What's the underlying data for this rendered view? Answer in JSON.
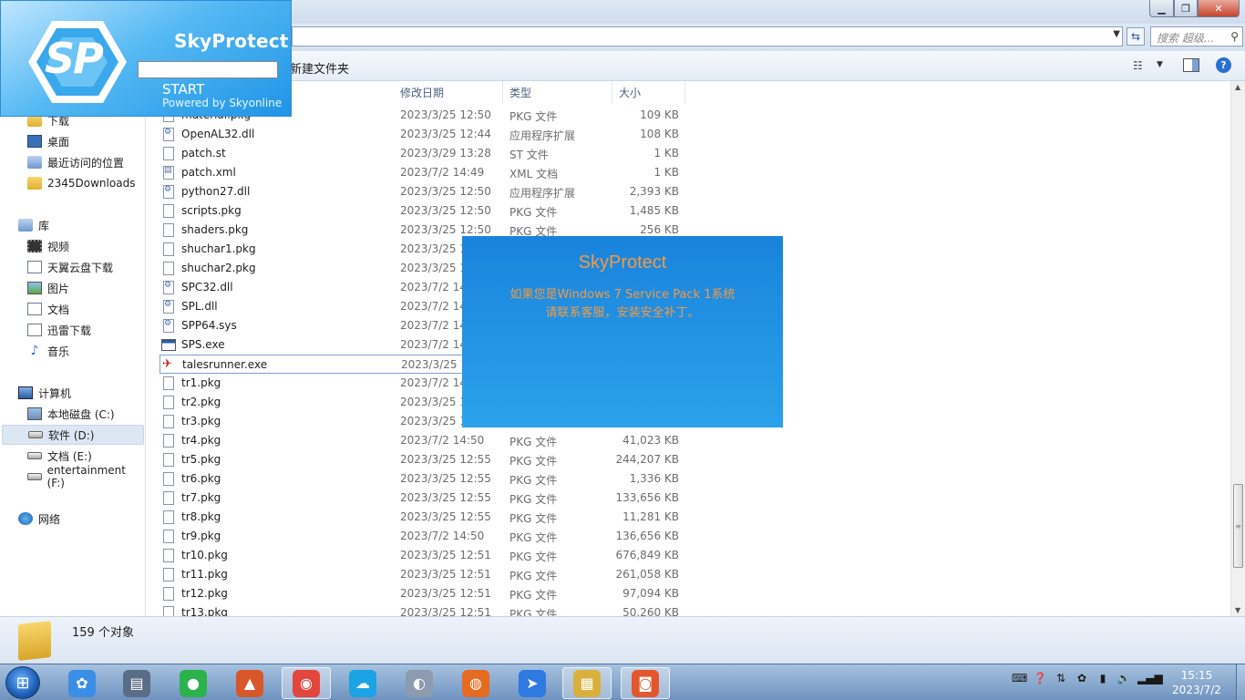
{
  "window": {
    "search_placeholder": "搜索 超级...",
    "toolbar": {
      "new_folder": "新建文件夹"
    }
  },
  "nav": {
    "favorites": [
      "下载",
      "桌面",
      "最近访问的位置",
      "2345Downloads"
    ],
    "libraries_label": "库",
    "libraries": [
      "视频",
      "天翼云盘下载",
      "图片",
      "文档",
      "迅雷下载",
      "音乐"
    ],
    "computer_label": "计算机",
    "drives": [
      "本地磁盘 (C:)",
      "软件 (D:)",
      "文档 (E:)",
      "entertainment (F:)"
    ],
    "network_label": "网络"
  },
  "columns": {
    "date": "修改日期",
    "type": "类型",
    "size": "大小"
  },
  "files": [
    {
      "name": "material.pkg",
      "date": "2023/3/25 12:50",
      "type": "PKG 文件",
      "size": "109 KB",
      "icon": "file"
    },
    {
      "name": "OpenAL32.dll",
      "date": "2023/3/25 12:44",
      "type": "应用程序扩展",
      "size": "108 KB",
      "icon": "dll"
    },
    {
      "name": "patch.st",
      "date": "2023/3/29 13:28",
      "type": "ST 文件",
      "size": "1 KB",
      "icon": "file"
    },
    {
      "name": "patch.xml",
      "date": "2023/7/2 14:49",
      "type": "XML 文档",
      "size": "1 KB",
      "icon": "xml"
    },
    {
      "name": "python27.dll",
      "date": "2023/3/25 12:50",
      "type": "应用程序扩展",
      "size": "2,393 KB",
      "icon": "dll"
    },
    {
      "name": "scripts.pkg",
      "date": "2023/3/25 12:50",
      "type": "PKG 文件",
      "size": "1,485 KB",
      "icon": "file"
    },
    {
      "name": "shaders.pkg",
      "date": "2023/3/25 12:50",
      "type": "PKG 文件",
      "size": "256 KB",
      "icon": "file"
    },
    {
      "name": "shuchar1.pkg",
      "date": "2023/3/25 1",
      "type": "",
      "size": "",
      "icon": "file"
    },
    {
      "name": "shuchar2.pkg",
      "date": "2023/3/25 1",
      "type": "",
      "size": "",
      "icon": "file"
    },
    {
      "name": "SPC32.dll",
      "date": "2023/7/2 14",
      "type": "",
      "size": "",
      "icon": "dll"
    },
    {
      "name": "SPL.dll",
      "date": "2023/7/2 14",
      "type": "",
      "size": "",
      "icon": "dll"
    },
    {
      "name": "SPP64.sys",
      "date": "2023/7/2 14",
      "type": "",
      "size": "",
      "icon": "dll"
    },
    {
      "name": "SPS.exe",
      "date": "2023/7/2 14",
      "type": "",
      "size": "",
      "icon": "exe"
    },
    {
      "name": "talesrunner.exe",
      "date": "2023/3/25 1",
      "type": "",
      "size": "",
      "icon": "app"
    },
    {
      "name": "tr1.pkg",
      "date": "2023/7/2 14",
      "type": "",
      "size": "",
      "icon": "file"
    },
    {
      "name": "tr2.pkg",
      "date": "2023/3/25 1",
      "type": "",
      "size": "",
      "icon": "file"
    },
    {
      "name": "tr3.pkg",
      "date": "2023/3/25 1",
      "type": "",
      "size": "",
      "icon": "file"
    },
    {
      "name": "tr4.pkg",
      "date": "2023/7/2 14:50",
      "type": "PKG 文件",
      "size": "41,023 KB",
      "icon": "file"
    },
    {
      "name": "tr5.pkg",
      "date": "2023/3/25 12:55",
      "type": "PKG 文件",
      "size": "244,207 KB",
      "icon": "file"
    },
    {
      "name": "tr6.pkg",
      "date": "2023/3/25 12:55",
      "type": "PKG 文件",
      "size": "1,336 KB",
      "icon": "file"
    },
    {
      "name": "tr7.pkg",
      "date": "2023/3/25 12:55",
      "type": "PKG 文件",
      "size": "133,656 KB",
      "icon": "file"
    },
    {
      "name": "tr8.pkg",
      "date": "2023/3/25 12:55",
      "type": "PKG 文件",
      "size": "11,281 KB",
      "icon": "file"
    },
    {
      "name": "tr9.pkg",
      "date": "2023/7/2 14:50",
      "type": "PKG 文件",
      "size": "136,656 KB",
      "icon": "file"
    },
    {
      "name": "tr10.pkg",
      "date": "2023/3/25 12:51",
      "type": "PKG 文件",
      "size": "676,849 KB",
      "icon": "file"
    },
    {
      "name": "tr11.pkg",
      "date": "2023/3/25 12:51",
      "type": "PKG 文件",
      "size": "261,058 KB",
      "icon": "file"
    },
    {
      "name": "tr12.pkg",
      "date": "2023/3/25 12:51",
      "type": "PKG 文件",
      "size": "97,094 KB",
      "icon": "file"
    },
    {
      "name": "tr13.pkg",
      "date": "2023/3/25 12:51",
      "type": "PKG 文件",
      "size": "50,260 KB",
      "icon": "file"
    }
  ],
  "status": {
    "count": "159 个对象"
  },
  "splash": {
    "title": "SkyProtect",
    "start": "START",
    "powered": "Powered by Skyonline",
    "logo_text": "SP"
  },
  "popup": {
    "title": "SkyProtect",
    "line1": "如果您是Windows 7 Service Pack 1系统",
    "line2": "请联系客服，安装安全补丁。"
  },
  "clock": {
    "time": "15:15",
    "date": "2023/7/2"
  },
  "taskbar": {
    "apps": [
      {
        "name": "baidu-netdisk",
        "glyph": "✿",
        "color": "#3a8ee6"
      },
      {
        "name": "document-viewer",
        "glyph": "▤",
        "color": "#5a6d86"
      },
      {
        "name": "wechat",
        "glyph": "●",
        "color": "#2bb24c"
      },
      {
        "name": "matlab",
        "glyph": "▲",
        "color": "#d7572b"
      },
      {
        "name": "chrome",
        "glyph": "◉",
        "color": "#e2463d"
      },
      {
        "name": "tianyi-cloud",
        "glyph": "☁",
        "color": "#1ba3e3"
      },
      {
        "name": "qq-game",
        "glyph": "◐",
        "color": "#8c9bb0"
      },
      {
        "name": "firefox",
        "glyph": "◍",
        "color": "#e66a1f"
      },
      {
        "name": "feishu",
        "glyph": "➤",
        "color": "#2d7ae0"
      },
      {
        "name": "file-explorer",
        "glyph": "▦",
        "color": "#d9b03c"
      },
      {
        "name": "slides-app",
        "glyph": "◙",
        "color": "#e4572e"
      }
    ]
  },
  "colors": {
    "popup_text": "#f39a44",
    "accent": "#1a83dc"
  }
}
